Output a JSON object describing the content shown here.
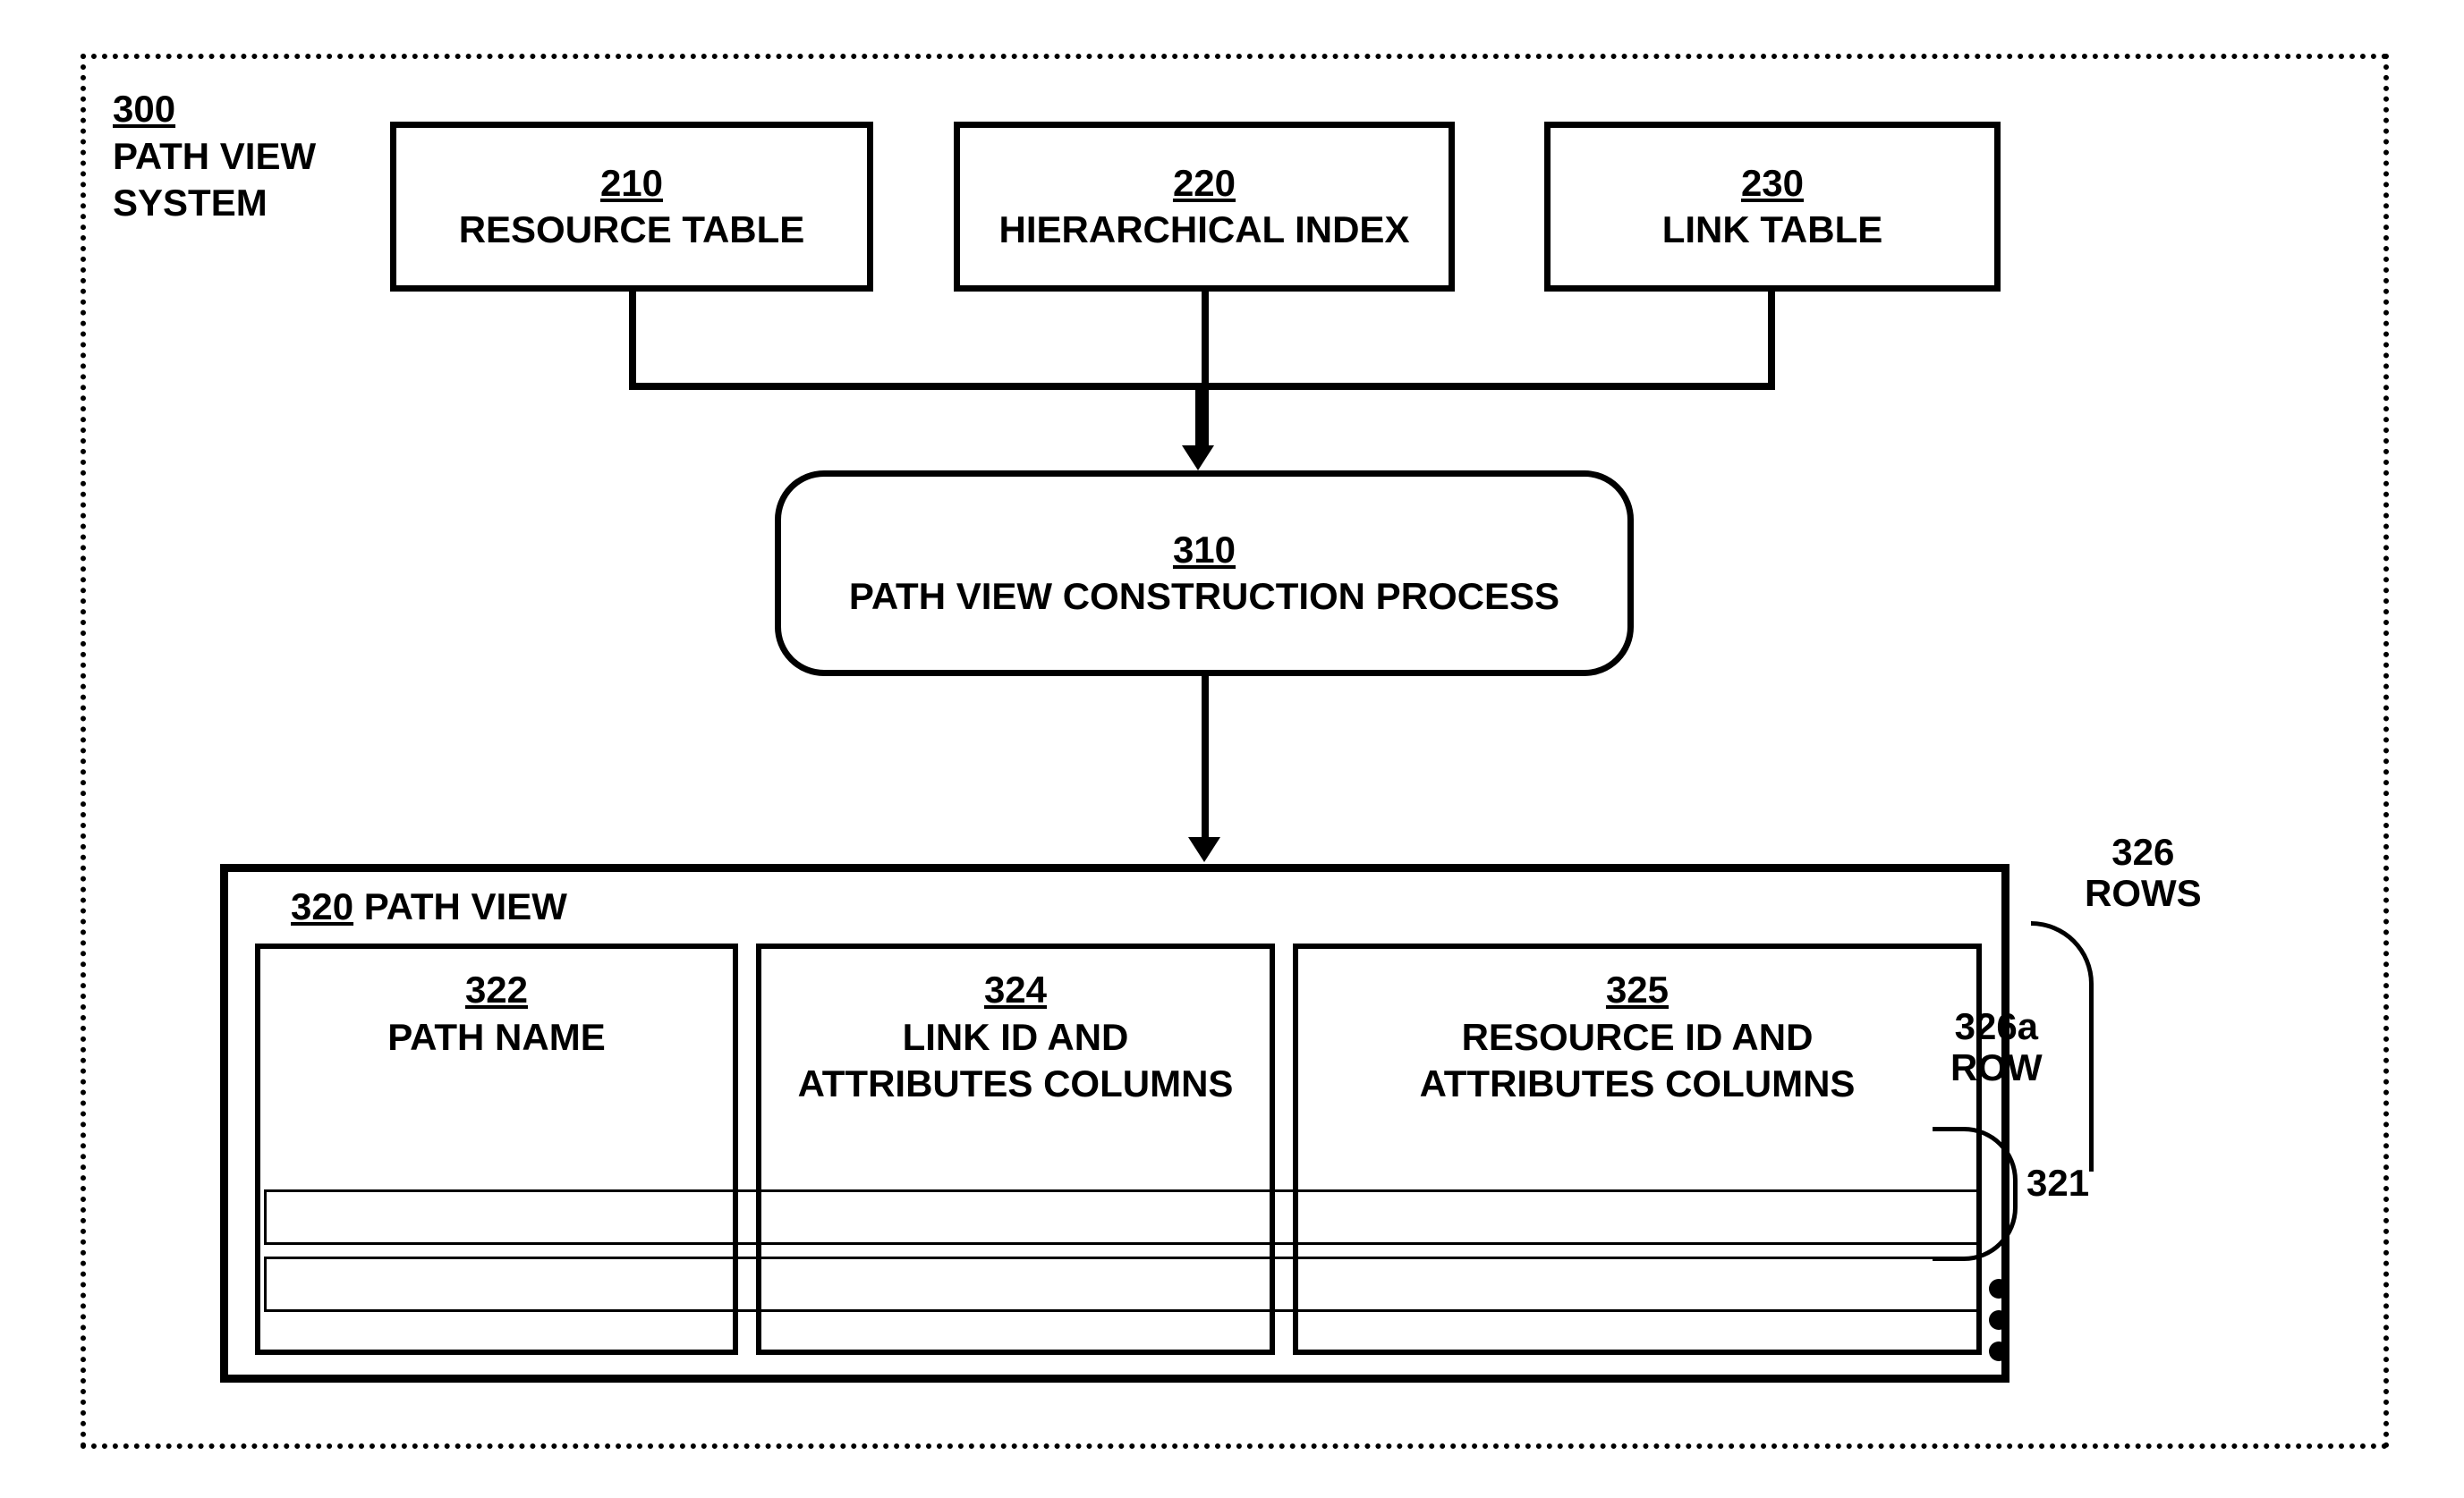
{
  "system": {
    "ref": "300",
    "label": "PATH VIEW\nSYSTEM"
  },
  "inputs": {
    "resource_table": {
      "ref": "210",
      "label": "RESOURCE TABLE"
    },
    "hierarchical_index": {
      "ref": "220",
      "label": "HIERARCHICAL INDEX"
    },
    "link_table": {
      "ref": "230",
      "label": "LINK TABLE"
    }
  },
  "process": {
    "ref": "310",
    "label": "PATH VIEW CONSTRUCTION PROCESS"
  },
  "path_view": {
    "ref": "320",
    "title": "PATH VIEW",
    "columns": {
      "path_name": {
        "ref": "322",
        "label": "PATH NAME"
      },
      "link": {
        "ref": "324",
        "label": "LINK ID AND\nATTRIBUTES COLUMNS"
      },
      "resource": {
        "ref": "325",
        "label": "RESOURCE ID AND\nATTRIBUTES COLUMNS"
      }
    },
    "rows_group_ref": "321",
    "rows_label": {
      "ref": "326",
      "label": "ROWS"
    },
    "row_a": {
      "ref": "326a",
      "label": "ROW"
    }
  }
}
